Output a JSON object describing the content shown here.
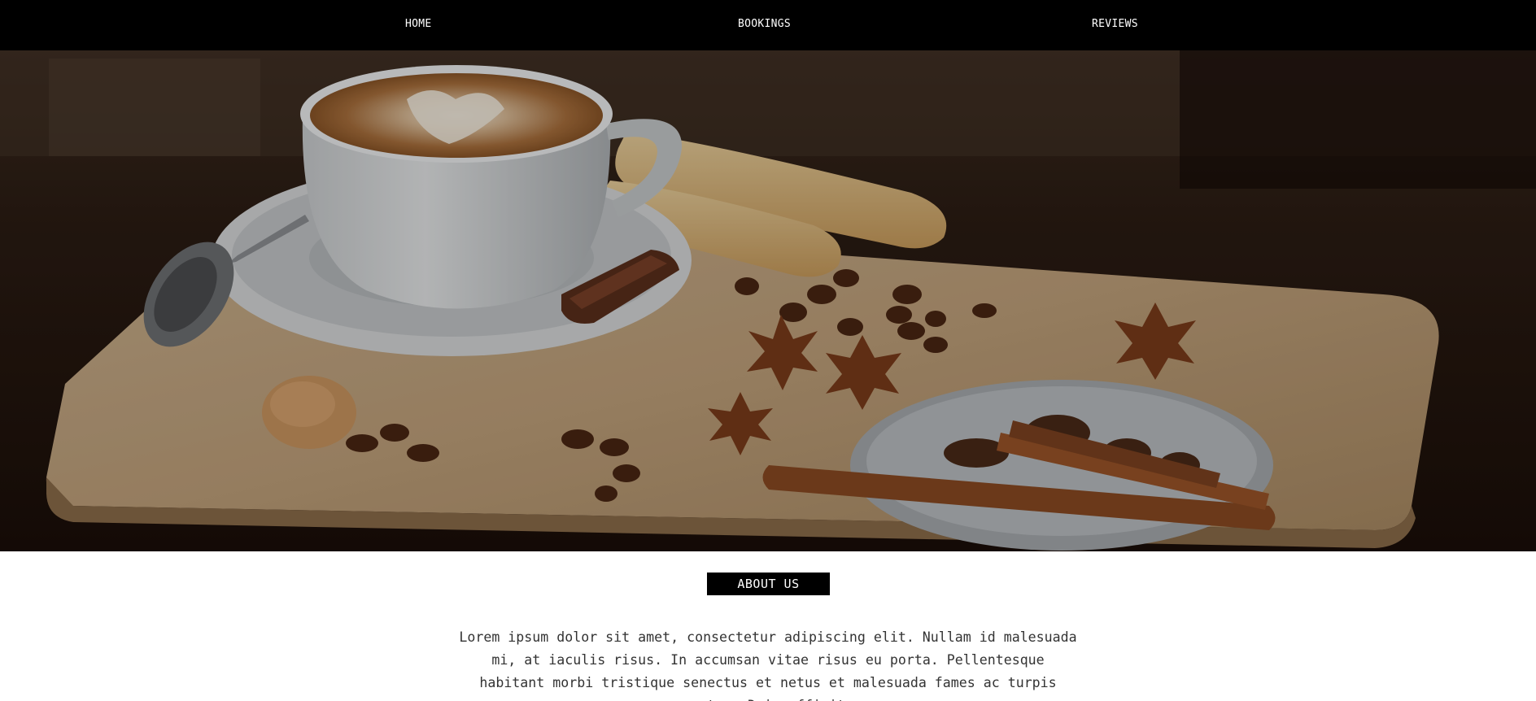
{
  "nav": {
    "items": [
      {
        "label": "HOME"
      },
      {
        "label": "BOOKINGS"
      },
      {
        "label": "REVIEWS"
      }
    ]
  },
  "hero": {
    "image_subject": "latte-art cup on saucer, ladyfingers, coffee beans, star anise, cinnamon sticks on wooden board"
  },
  "about": {
    "heading": "ABOUT US",
    "body": "Lorem ipsum dolor sit amet, consectetur adipiscing elit. Nullam id malesuada mi, at iaculis risus. In accumsan vitae risus eu porta. Pellentesque habitant morbi tristique senectus et netus et malesuada fames ac turpis egestas. Duis efficitur"
  },
  "colors": {
    "nav_bg": "#000000",
    "nav_text": "#ffffff",
    "badge_bg": "#000000",
    "body_text": "#333333"
  }
}
